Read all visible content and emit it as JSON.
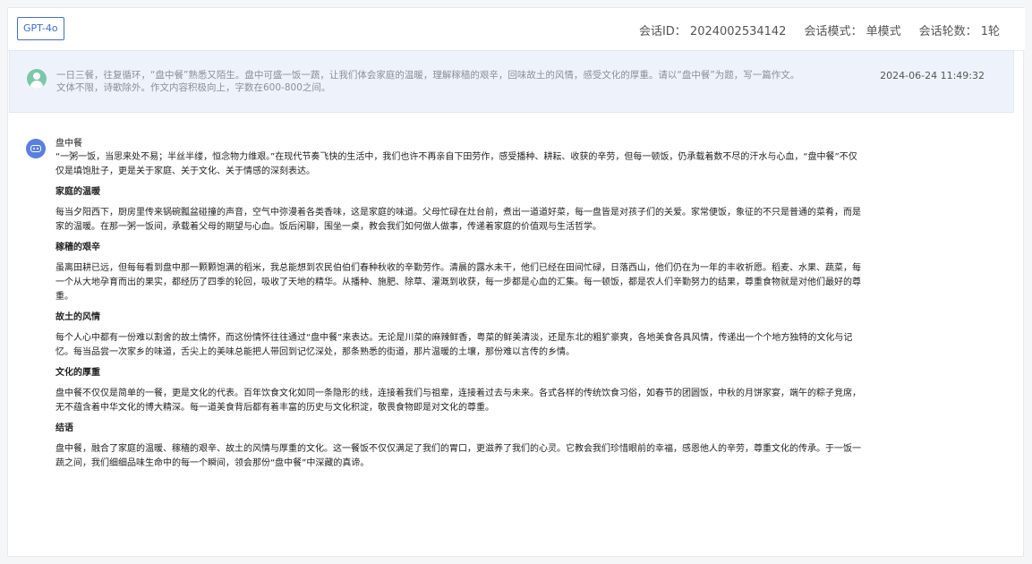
{
  "header": {
    "model": "GPT-4o",
    "session_id": "会话ID：  2024002534142",
    "session_mode": "会话模式：  单模式",
    "session_rounds": "会话轮数：  1轮"
  },
  "user_message": {
    "line1": "一日三餐，往复循环，“盘中餐”熟悉又陌生。盘中可盛一饭一蔬，让我们体会家庭的温暖，理解稼穑的艰辛，回味故土的风情，感受文化的厚重。请以“盘中餐”为题，写一篇作文。",
    "line2": "文体不限，诗歌除外。作文内容积极向上，字数在600-800之间。",
    "time": "2024-06-24 11:49:32"
  },
  "bot_message": {
    "title": "盘中餐",
    "intro": "“一粥一饭，当思来处不易；半丝半缕，恒念物力维艰。”在现代节奏飞快的生活中，我们也许不再亲自下田劳作，感受播种、耕耘、收获的辛劳，但每一顿饭，仍承载着数不尽的汗水与心血，“盘中餐”不仅仅是填饱肚子，更是关于家庭、关于文化、关于情感的深刻表达。",
    "sections": [
      {
        "heading": "家庭的温暖",
        "text": "每当夕阳西下，厨房里传来锅碗瓢盆碰撞的声音，空气中弥漫着各类香味，这是家庭的味道。父母忙碌在灶台前，煮出一道道好菜，每一盘皆是对孩子们的关爱。家常便饭，象征的不只是普通的菜肴，而是家的温暖。在那一粥一饭间，承载着父母的期望与心血。饭后闲聊，围坐一桌，教会我们如何做人做事，传递着家庭的价值观与生活哲学。"
      },
      {
        "heading": "稼穑的艰辛",
        "text": "虽离田耕已远，但每每看到盘中那一颗颗饱满的稻米，我总能想到农民伯伯们春种秋收的辛勤劳作。清晨的露水未干，他们已经在田间忙碌，日落西山，他们仍在为一年的丰收祈愿。稻麦、水果、蔬菜，每一个从大地孕育而出的果实，都经历了四季的轮回，吸收了天地的精华。从播种、施肥、除草、灌溉到收获，每一步都是心血的汇集。每一顿饭，都是农人们辛勤努力的结果，尊重食物就是对他们最好的尊重。"
      },
      {
        "heading": "故土的风情",
        "text": "每个人心中都有一份难以割舍的故土情怀，而这份情怀往往通过“盘中餐”来表达。无论是川菜的麻辣鲜香，粤菜的鲜美清淡，还是东北的粗犷豪爽，各地美食各具风情，传递出一个个地方独特的文化与记忆。每当品尝一次家乡的味道，舌尖上的美味总能把人带回到记忆深处，那条熟悉的街道，那片温暖的土壤，那份难以言传的乡情。"
      },
      {
        "heading": "文化的厚重",
        "text": "盘中餐不仅仅是简单的一餐，更是文化的代表。百年饮食文化如同一条隐形的线，连接着我们与祖辈，连接着过去与未来。各式各样的传统饮食习俗，如春节的团圆饭，中秋的月饼家宴，端午的粽子竞席，无不蕴含着中华文化的博大精深。每一道美食背后都有着丰富的历史与文化积淀，敬畏食物即是对文化的尊重。"
      },
      {
        "heading": "结语",
        "text": "盘中餐，融合了家庭的温暖、稼穑的艰辛、故土的风情与厚重的文化。这一餐饭不仅仅满足了我们的胃口，更滋养了我们的心灵。它教会我们珍惜眼前的幸福，感恩他人的辛劳，尊重文化的传承。于一饭一蔬之间，我们细细品味生命中的每一个瞬间，领会那份“盘中餐”中深藏的真谛。"
      }
    ]
  }
}
